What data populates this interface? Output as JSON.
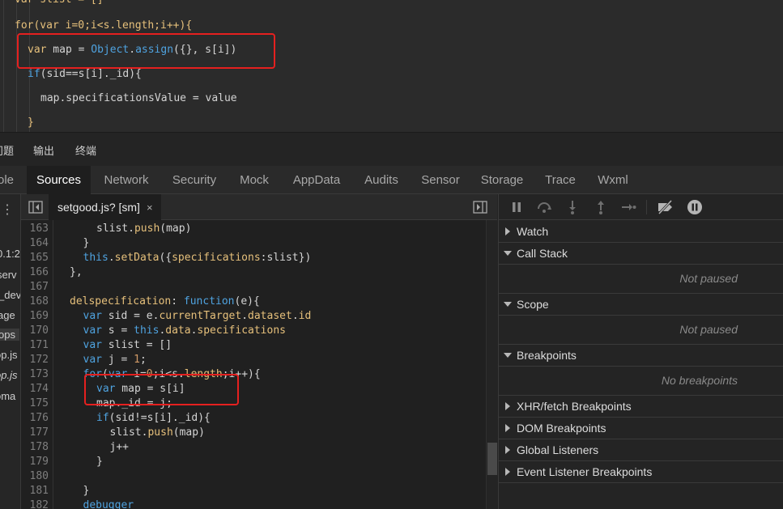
{
  "top_editor": {
    "lines": [
      {
        "segs": [
          [
            "var slist = []",
            "#e6c07b"
          ]
        ]
      },
      {
        "segs": [
          [
            "for(var i=0;i<s.length;i++){",
            "#e6c07b"
          ]
        ]
      },
      {
        "segs": [
          [
            "var",
            "#e6c07b"
          ],
          [
            " map = ",
            "#d4d4d4"
          ],
          [
            "Object",
            "#4fa3e0"
          ],
          [
            ".",
            "#d4d4d4"
          ],
          [
            "assign",
            "#4fa3e0"
          ],
          [
            "({}, s[i])",
            "#d4d4d4"
          ]
        ]
      },
      {
        "segs": [
          [
            "if",
            "#4fa3e0"
          ],
          [
            "(sid==s[i]._id){",
            "#d4d4d4"
          ]
        ]
      },
      {
        "segs": [
          [
            "map.specificationsValue = value",
            "#d4d4d4"
          ]
        ]
      },
      {
        "segs": [
          [
            "}",
            "#e6c07b"
          ]
        ]
      }
    ]
  },
  "panel_tabs": [
    "问题",
    "输出",
    "终端"
  ],
  "devtools_tabs": [
    "ole",
    "Sources",
    "Network",
    "Security",
    "Mock",
    "AppData",
    "Audits",
    "Sensor",
    "Storage",
    "Trace",
    "Wxml"
  ],
  "active_tab": "Sources",
  "sidebar_items": [
    "0.1:2",
    "serv",
    "_dev",
    "age",
    "ops",
    "op.js",
    "op.js",
    "oma"
  ],
  "file_tab": {
    "name": "setgood.js? [sm]",
    "close": "×"
  },
  "code": {
    "line_numbers": [
      "163",
      "164",
      "165",
      "166",
      "167",
      "168",
      "169",
      "170",
      "171",
      "172",
      "173",
      "174",
      "175",
      "176",
      "177",
      "178",
      "179",
      "180",
      "181",
      "182"
    ],
    "lines": [
      {
        "indent": 2,
        "segs": [
          [
            "slist.",
            "#d4d4d4"
          ],
          [
            "push",
            "#e6c07b"
          ],
          [
            "(map)",
            "#d4d4d4"
          ]
        ]
      },
      {
        "indent": 1,
        "segs": [
          [
            "}",
            "#d4d4d4"
          ]
        ]
      },
      {
        "indent": 1,
        "segs": [
          [
            "this",
            "#4fa3e0"
          ],
          [
            ".",
            "#d4d4d4"
          ],
          [
            "setData",
            "#e6c07b"
          ],
          [
            "({",
            "#d4d4d4"
          ],
          [
            "specifications",
            "#e6c07b"
          ],
          [
            ":slist})",
            "#d4d4d4"
          ]
        ]
      },
      {
        "indent": 0,
        "segs": [
          [
            "},",
            "#d4d4d4"
          ]
        ]
      },
      {
        "indent": 0,
        "segs": []
      },
      {
        "indent": 0,
        "segs": [
          [
            "delspecification",
            "#e6c07b"
          ],
          [
            ": ",
            "#d4d4d4"
          ],
          [
            "function",
            "#4fa3e0"
          ],
          [
            "(e){",
            "#d4d4d4"
          ]
        ]
      },
      {
        "indent": 1,
        "segs": [
          [
            "var",
            "#4fa3e0"
          ],
          [
            " sid = e.",
            "#d4d4d4"
          ],
          [
            "currentTarget",
            "#e6c07b"
          ],
          [
            ".",
            "#d4d4d4"
          ],
          [
            "dataset",
            "#e6c07b"
          ],
          [
            ".",
            "#d4d4d4"
          ],
          [
            "id",
            "#e6c07b"
          ]
        ]
      },
      {
        "indent": 1,
        "segs": [
          [
            "var",
            "#4fa3e0"
          ],
          [
            " s = ",
            "#d4d4d4"
          ],
          [
            "this",
            "#4fa3e0"
          ],
          [
            ".",
            "#d4d4d4"
          ],
          [
            "data",
            "#e6c07b"
          ],
          [
            ".",
            "#d4d4d4"
          ],
          [
            "specifications",
            "#e6c07b"
          ]
        ]
      },
      {
        "indent": 1,
        "segs": [
          [
            "var",
            "#4fa3e0"
          ],
          [
            " slist = []",
            "#d4d4d4"
          ]
        ]
      },
      {
        "indent": 1,
        "segs": [
          [
            "var",
            "#4fa3e0"
          ],
          [
            " j = ",
            "#d4d4d4"
          ],
          [
            "1",
            "#d19a66"
          ],
          [
            ";",
            "#d4d4d4"
          ]
        ]
      },
      {
        "indent": 1,
        "segs": [
          [
            "for",
            "#4fa3e0"
          ],
          [
            "(",
            "#d4d4d4"
          ],
          [
            "var",
            "#4fa3e0"
          ],
          [
            " i=",
            "#d4d4d4"
          ],
          [
            "0",
            "#d19a66"
          ],
          [
            ";i<s.",
            "#d4d4d4"
          ],
          [
            "length",
            "#e6c07b"
          ],
          [
            ";i++){",
            "#d4d4d4"
          ]
        ]
      },
      {
        "indent": 2,
        "segs": [
          [
            "var",
            "#4fa3e0"
          ],
          [
            " map = s[i]",
            "#d4d4d4"
          ]
        ]
      },
      {
        "indent": 2,
        "segs": [
          [
            "map._id = j;",
            "#d4d4d4"
          ]
        ]
      },
      {
        "indent": 2,
        "segs": [
          [
            "if",
            "#4fa3e0"
          ],
          [
            "(sid!=s[i]._id){",
            "#d4d4d4"
          ]
        ]
      },
      {
        "indent": 3,
        "segs": [
          [
            "slist.",
            "#d4d4d4"
          ],
          [
            "push",
            "#e6c07b"
          ],
          [
            "(map)",
            "#d4d4d4"
          ]
        ]
      },
      {
        "indent": 3,
        "segs": [
          [
            "j++",
            "#d4d4d4"
          ]
        ]
      },
      {
        "indent": 2,
        "segs": [
          [
            "}",
            "#d4d4d4"
          ]
        ]
      },
      {
        "indent": 0,
        "segs": []
      },
      {
        "indent": 1,
        "segs": [
          [
            "}",
            "#d4d4d4"
          ]
        ]
      },
      {
        "indent": 1,
        "segs": [
          [
            "debugger",
            "#4fa3e0"
          ]
        ]
      }
    ]
  },
  "debugger": {
    "sections": [
      {
        "title": "Watch",
        "expanded": false,
        "message": ""
      },
      {
        "title": "Call Stack",
        "expanded": true,
        "message": "Not paused"
      },
      {
        "title": "Scope",
        "expanded": true,
        "message": "Not paused"
      },
      {
        "title": "Breakpoints",
        "expanded": true,
        "message": "No breakpoints"
      },
      {
        "title": "XHR/fetch Breakpoints",
        "expanded": false,
        "message": ""
      },
      {
        "title": "DOM Breakpoints",
        "expanded": false,
        "message": ""
      },
      {
        "title": "Global Listeners",
        "expanded": false,
        "message": ""
      },
      {
        "title": "Event Listener Breakpoints",
        "expanded": false,
        "message": ""
      }
    ]
  },
  "colors": {
    "highlight": "#e5201f",
    "accent_keyword": "#4fa3e0",
    "accent_ident": "#e6c07b"
  }
}
